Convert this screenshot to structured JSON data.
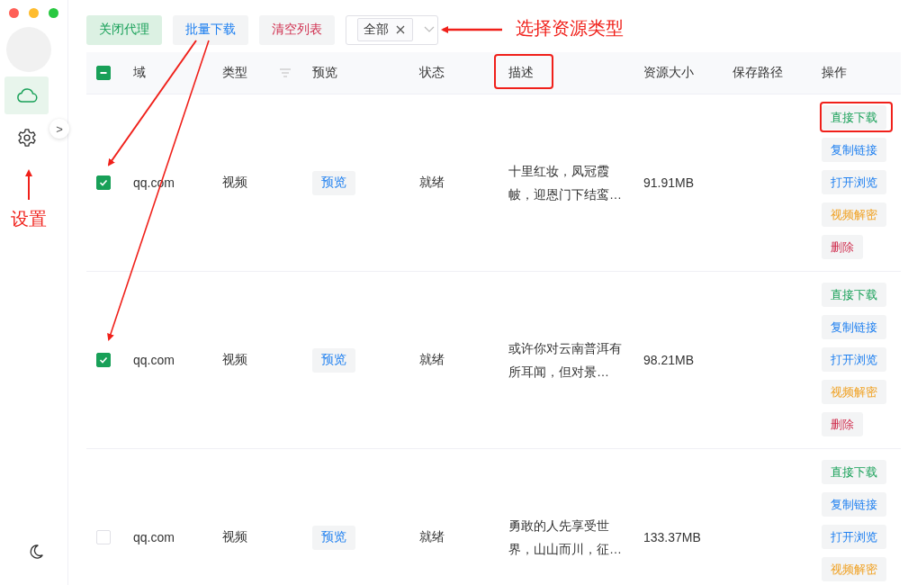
{
  "sidebar": {
    "items": [
      {
        "selected": true
      },
      {
        "selected": false
      }
    ],
    "expand_toggle": ">"
  },
  "toolbar": {
    "buttons": [
      {
        "label": "关闭代理",
        "kind": "success"
      },
      {
        "label": "批量下载",
        "kind": "info"
      },
      {
        "label": "清空列表",
        "kind": "danger"
      }
    ],
    "type_filter": {
      "tags": [
        "全部"
      ]
    }
  },
  "table": {
    "select_all": {
      "indeterminate": true
    },
    "columns": [
      "域",
      "类型",
      "预览",
      "状态",
      "描述",
      "资源大小",
      "保存路径",
      "操作"
    ],
    "rows": [
      {
        "checked": true,
        "domain": "qq.com",
        "type": "视频",
        "preview": "预览",
        "status": "就绪",
        "description": "十里红妆，凤冠霞帔，迎恩门下结鸾…",
        "size": "91.91MB",
        "actions": [
          {
            "label": "直接下载",
            "kind": "download"
          },
          {
            "label": "复制链接",
            "kind": "copy"
          },
          {
            "label": "打开浏览",
            "kind": "open"
          },
          {
            "label": "视频解密",
            "kind": "decrypt"
          },
          {
            "label": "删除",
            "kind": "delete"
          }
        ]
      },
      {
        "checked": true,
        "domain": "qq.com",
        "type": "视频",
        "preview": "预览",
        "status": "就绪",
        "description": "或许你对云南普洱有所耳闻，但对景…",
        "size": "98.21MB",
        "actions": [
          {
            "label": "直接下载",
            "kind": "download"
          },
          {
            "label": "复制链接",
            "kind": "copy"
          },
          {
            "label": "打开浏览",
            "kind": "open"
          },
          {
            "label": "视频解密",
            "kind": "decrypt"
          },
          {
            "label": "删除",
            "kind": "delete"
          }
        ]
      },
      {
        "checked": false,
        "domain": "qq.com",
        "type": "视频",
        "preview": "预览",
        "status": "就绪",
        "description": "勇敢的人先享受世界，山山而川，征…",
        "size": "133.37MB",
        "actions": [
          {
            "label": "直接下载",
            "kind": "download"
          },
          {
            "label": "复制链接",
            "kind": "copy"
          },
          {
            "label": "打开浏览",
            "kind": "open"
          },
          {
            "label": "视频解密",
            "kind": "decrypt"
          }
        ]
      }
    ]
  },
  "annotations": {
    "labels": [
      "选择资源类型",
      "设置"
    ]
  }
}
